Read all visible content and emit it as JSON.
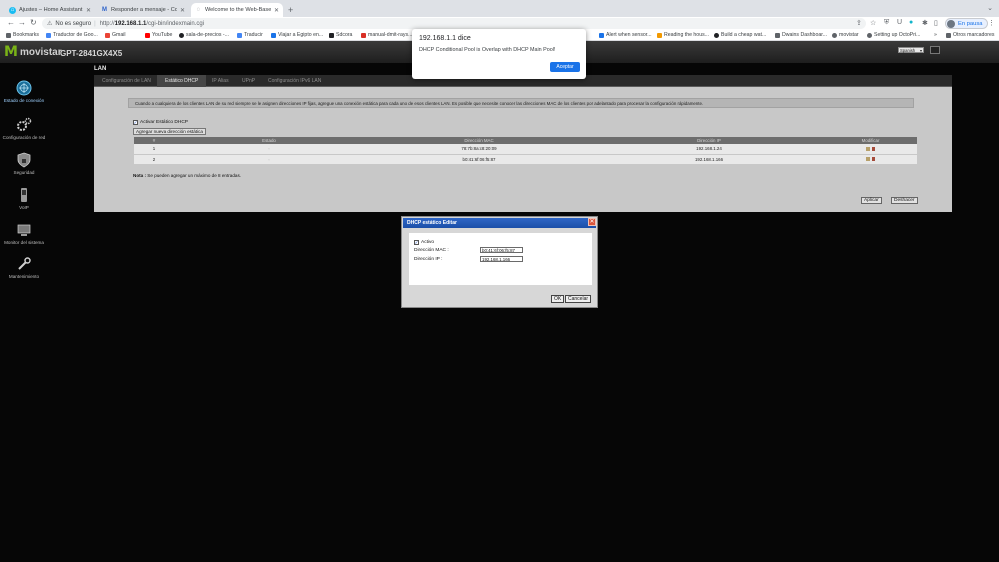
{
  "browser": {
    "tabs": [
      {
        "title": "Ajustes – Home Assistant",
        "color": "#18bcf2",
        "glyph": "⌂"
      },
      {
        "title": "Responder a mensaje - Comun",
        "color": "#2d62c9",
        "glyph": "M"
      },
      {
        "title": "Welcome to the Web-Based",
        "color": "#5f6368",
        "glyph": "◌"
      }
    ],
    "address": {
      "security_label": "No es seguro",
      "url_scheme": "http://",
      "url_host": "192.168.1.1",
      "url_path": "/cgi-bin/indexmain.cgi"
    },
    "profile_label": "En pausa",
    "bookmarks": [
      {
        "label": "Bookmarks",
        "color": "#5f6368"
      },
      {
        "label": "Traductor de Goo...",
        "color": "#4285f4"
      },
      {
        "label": "Gmail",
        "color": "#ea4335"
      },
      {
        "label": "YouTube",
        "color": "#ff0000"
      },
      {
        "label": "sala-de-precios -...",
        "color": "#202124"
      },
      {
        "label": "Traducir",
        "color": "#4285f4"
      },
      {
        "label": "Viajar a Egipto en...",
        "color": "#1a73e8"
      },
      {
        "label": "Sdcora",
        "color": "#202124"
      },
      {
        "label": "manual-dmit-rays...",
        "color": "#d93025"
      },
      {
        "label": "Alert when sensor...",
        "color": "#1a73e8"
      },
      {
        "label": "Reading the hous...",
        "color": "#f29900"
      },
      {
        "label": "Build a cheap wat...",
        "color": "#202124"
      },
      {
        "label": "Dwains Dashboar...",
        "color": "#5f6368"
      },
      {
        "label": "movistar",
        "color": "#5f6368"
      },
      {
        "label": "Setting up OctoPri...",
        "color": "#5f6368"
      }
    ],
    "other_bookmarks": "Otros marcadores"
  },
  "router": {
    "brand": "movistar",
    "model": "GPT-2841GX4X5",
    "language": "Spanish",
    "section": "LAN",
    "sidebar": [
      {
        "label": "Estado de conexión",
        "icon": "connection-status-icon"
      },
      {
        "label": "Configuración de red",
        "icon": "network-config-icon"
      },
      {
        "label": "Seguridad",
        "icon": "security-icon"
      },
      {
        "label": "VoIP",
        "icon": "voip-icon"
      },
      {
        "label": "Monitor del sistema",
        "icon": "system-monitor-icon"
      },
      {
        "label": "Mantenimiento",
        "icon": "maintenance-icon"
      }
    ],
    "tabs": [
      "Configuración de LAN",
      "Estático DHCP",
      "IP Alias",
      "UPnP",
      "Configuración IPv6 LAN"
    ],
    "active_tab": 1,
    "notice": "Cuando a cualquiera de los clientes LAN de su red siempre se le asignen direcciones IP fijas, agregue una conexión estática para cada uno de esos clientes LAN. Es posible que necesite conocer las direcciones MAC de los clientes por adelantado para procesar la configuración rápidamente.",
    "enable_label": "Activar Estático DHCP",
    "add_label": "Agregar nueva dirección estática",
    "table": {
      "headers": [
        "#",
        "Estado",
        "Dirección MAC",
        "Dirección IP",
        "Modificar"
      ],
      "rows": [
        {
          "n": "1",
          "state": "◦",
          "mac": "78:7b:8a:c8:20:09",
          "ip": "192.168.1.24"
        },
        {
          "n": "2",
          "state": "◦",
          "mac": "b0:41:6f:06:f5:87",
          "ip": "192.168.1.166"
        }
      ]
    },
    "note_label": "Nota :",
    "note_text": "Se pueden agregar un máximo de 8 entradas.",
    "apply_label": "Aplicar",
    "undo_label": "Deshacer"
  },
  "edit_dialog": {
    "title": "DHCP estático Editar",
    "active_label": "Activo",
    "mac_label": "Dirección MAC :",
    "mac_value": "b0:41:6f:06:f5:87",
    "ip_label": "Dirección IP :",
    "ip_value": "192.168.1.166",
    "ok_label": "OK",
    "cancel_label": "Cancelar"
  },
  "alert": {
    "title": "192.168.1.1 dice",
    "message": "DHCP Conditional Pool is Overlap with DHCP Main Pool!",
    "ok_label": "Aceptar"
  }
}
